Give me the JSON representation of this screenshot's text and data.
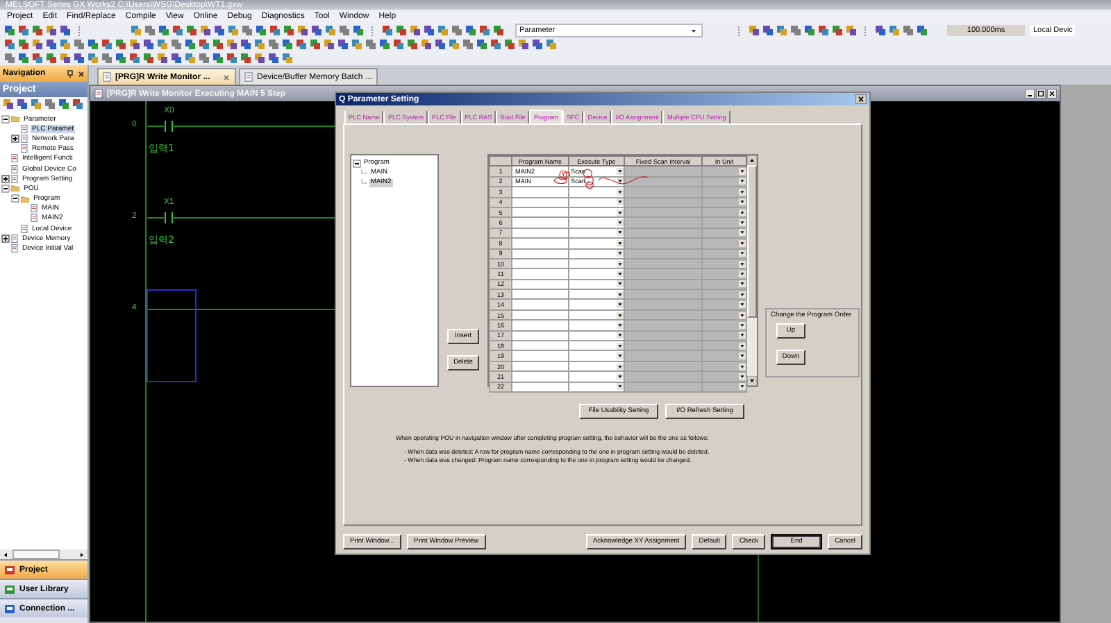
{
  "window": {
    "title": "MELSOFT Series GX Works2 C:\\Users\\WSG\\Desktop\\WT1.gxw"
  },
  "menu": [
    "Project",
    "Edit",
    "Find/Replace",
    "Compile",
    "View",
    "Online",
    "Debug",
    "Diagnostics",
    "Tool",
    "Window",
    "Help"
  ],
  "toolbar": {
    "combo_value": "Parameter",
    "scan_time": "100.000ms",
    "connection": "Local Devic"
  },
  "navigation": {
    "title": "Navigation",
    "section": "Project",
    "tree": [
      {
        "label": "Parameter",
        "expanded": true,
        "selected": false,
        "children": [
          {
            "label": "PLC Paramet",
            "selected": true
          },
          {
            "label": "Network Para",
            "expanded": false,
            "selected": false
          },
          {
            "label": "Remote Pass",
            "selected": false
          }
        ]
      },
      {
        "label": "Intelligent Functi",
        "selected": false
      },
      {
        "label": "Global Device Co",
        "selected": false
      },
      {
        "label": "Program Setting",
        "expanded": false,
        "selected": false
      },
      {
        "label": "POU",
        "expanded": true,
        "selected": false,
        "children": [
          {
            "label": "Program",
            "expanded": true,
            "selected": false,
            "children": [
              {
                "label": "MAIN",
                "selected": false
              },
              {
                "label": "MAIN2",
                "selected": false
              }
            ]
          },
          {
            "label": "Local Device",
            "selected": false
          }
        ]
      },
      {
        "label": "Device Memory",
        "expanded": false,
        "selected": false
      },
      {
        "label": "Device Initial Val",
        "selected": false
      }
    ],
    "bottom_buttons": [
      {
        "label": "Project",
        "selected": true
      },
      {
        "label": "User Library",
        "selected": false
      },
      {
        "label": "Connection ...",
        "selected": false
      }
    ]
  },
  "document_tabs": [
    {
      "label": "[PRG]R Write Monitor ...",
      "selected": true
    },
    {
      "label": "Device/Buffer Memory Batch ...",
      "selected": false
    }
  ],
  "editor": {
    "title": "[PRG]R Write Monitor Executing MAIN 5 Step",
    "rungs": [
      {
        "step": "0",
        "contact": "X0",
        "comment": "입력1",
        "selected": false
      },
      {
        "step": "2",
        "contact": "X1",
        "comment": "입력2",
        "selected": false
      },
      {
        "step": "4",
        "selected": true
      }
    ]
  },
  "dialog": {
    "title": "Q Parameter Setting",
    "tabs": [
      {
        "label": "PLC Name",
        "selected": false
      },
      {
        "label": "PLC System",
        "selected": false
      },
      {
        "label": "PLC File",
        "selected": false
      },
      {
        "label": "PLC RAS",
        "selected": false
      },
      {
        "label": "Boot File",
        "selected": false
      },
      {
        "label": "Program",
        "selected": true
      },
      {
        "label": "SFC",
        "selected": false
      },
      {
        "label": "Device",
        "selected": false
      },
      {
        "label": "I/O Assignment",
        "selected": false
      },
      {
        "label": "Multiple CPU Setting",
        "selected": false
      }
    ],
    "program_tree": [
      {
        "label": "Program",
        "expanded": true,
        "selected": false,
        "children": [
          {
            "label": "MAIN",
            "selected": false
          },
          {
            "label": "MAIN2",
            "selected": true
          }
        ]
      }
    ],
    "insert_button": "Insert",
    "delete_button": "Delete",
    "table": {
      "columns": [
        "Program Name",
        "Execute Type",
        "Fixed Scan Interval",
        "In Unit"
      ],
      "rows": [
        {
          "number": "1",
          "program_name": "MAIN2",
          "execute_type": "Scan"
        },
        {
          "number": "2",
          "program_name": "MAIN",
          "execute_type": "Scan"
        },
        {
          "number": "3"
        },
        {
          "number": "4"
        },
        {
          "number": "5"
        },
        {
          "number": "6"
        },
        {
          "number": "7"
        },
        {
          "number": "8"
        },
        {
          "number": "9"
        },
        {
          "number": "10"
        },
        {
          "number": "11"
        },
        {
          "number": "12"
        },
        {
          "number": "13"
        },
        {
          "number": "14"
        },
        {
          "number": "15"
        },
        {
          "number": "16"
        },
        {
          "number": "17"
        },
        {
          "number": "18"
        },
        {
          "number": "19"
        },
        {
          "number": "20"
        },
        {
          "number": "21"
        },
        {
          "number": "22"
        }
      ]
    },
    "order_group": {
      "title": "Change the Program Order",
      "buttons": [
        "Up",
        "Down"
      ]
    },
    "setting_buttons": [
      "File Usability Setting",
      "I/O Refresh Setting"
    ],
    "notes": {
      "intro": "When operating POU in navigation window after completing program setting, the behavior will be the one as follows:",
      "items": [
        "- When data was deleted: A row for program name corresponding to the one in program setting would be deleted.",
        "- When data was changed: Program name corresponding to the one in program setting would be changed."
      ]
    },
    "footer_buttons": [
      {
        "label": "Print Window...",
        "kind": "left"
      },
      {
        "label": "Print Window Preview",
        "kind": "left"
      },
      {
        "label": "Acknowledge XY Assignment",
        "kind": "right"
      },
      {
        "label": "Default",
        "kind": "right"
      },
      {
        "label": "Check",
        "kind": "right"
      },
      {
        "label": "End",
        "kind": "default"
      },
      {
        "label": "Cancel",
        "kind": "right"
      }
    ]
  }
}
